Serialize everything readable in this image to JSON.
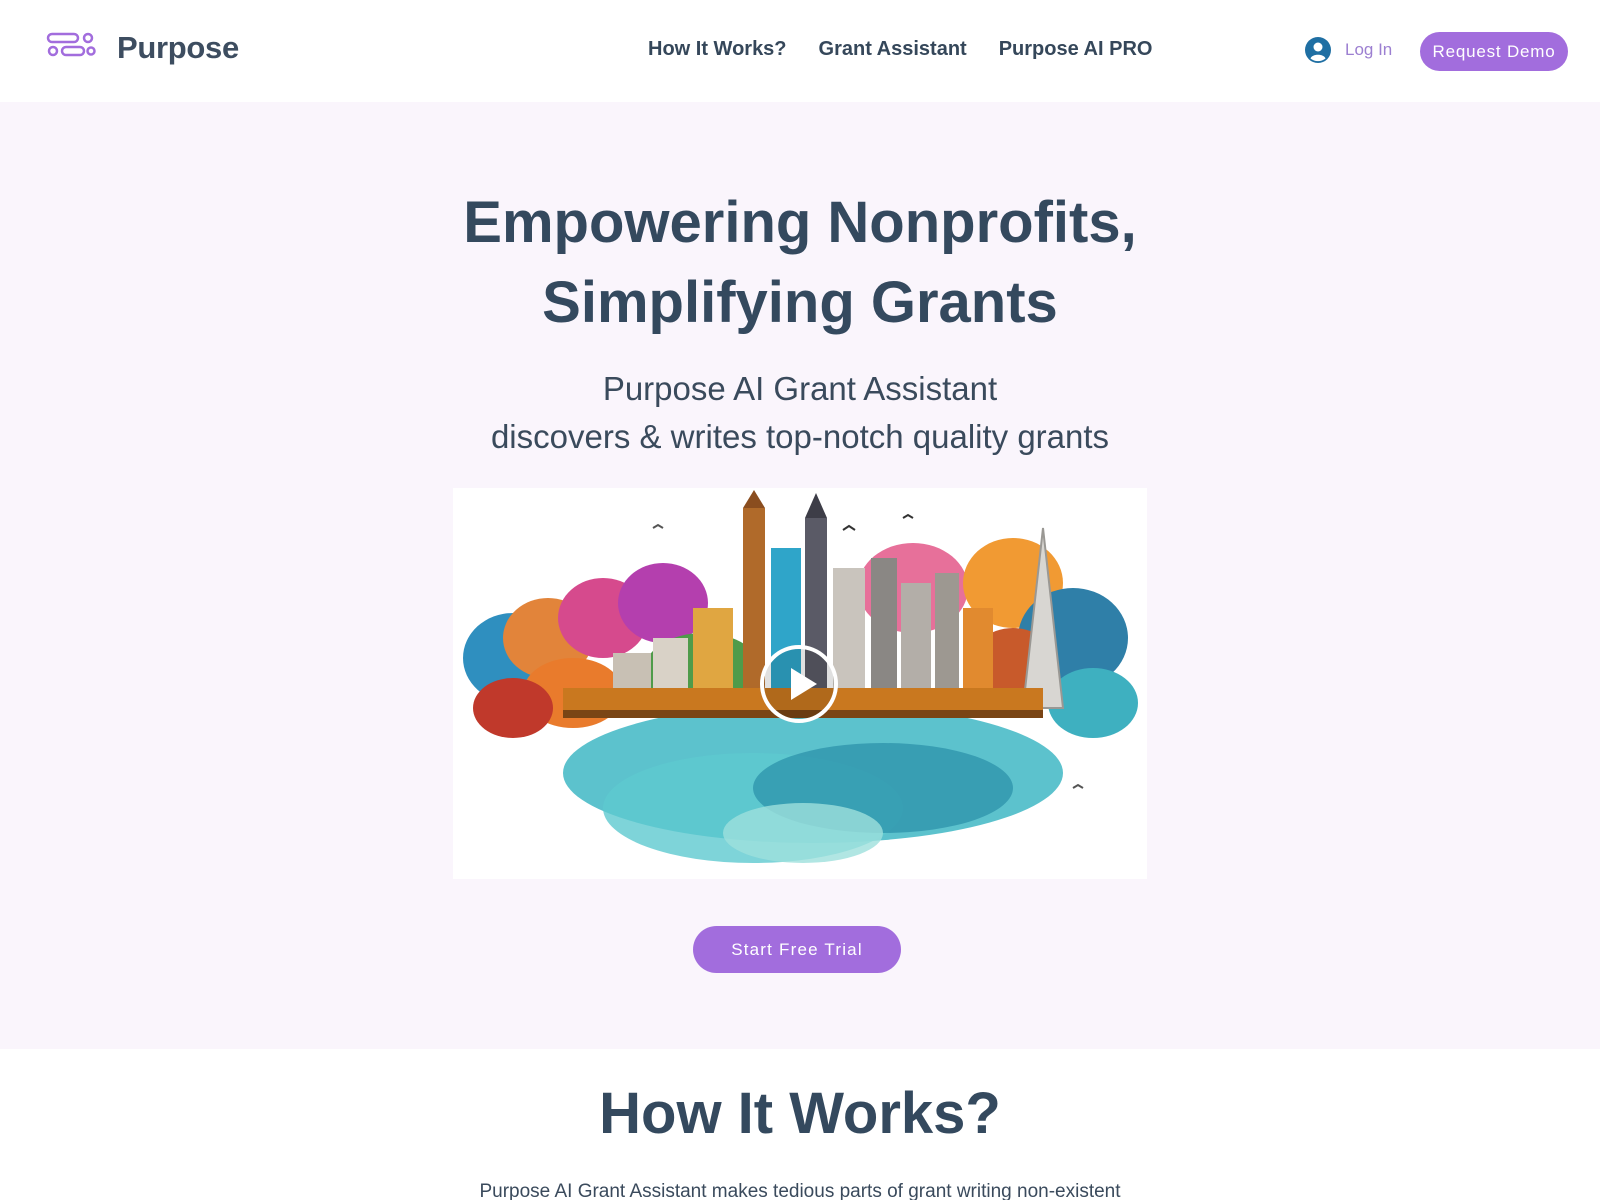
{
  "header": {
    "brand": "Purpose",
    "nav": [
      "How It Works?",
      "Grant Assistant",
      "Purpose AI PRO"
    ],
    "login_label": "Log In",
    "demo_label": "Request Demo",
    "logo_icon": "purpose-logo-icon",
    "login_icon": "user-avatar-icon"
  },
  "hero": {
    "headline_line1": "Empowering Nonprofits,",
    "headline_line2": "Simplifying Grants",
    "sub_line1": "Purpose AI Grant Assistant",
    "sub_line2": "discovers & writes top-notch quality grants",
    "video_icon": "play-icon",
    "cta_label": "Start Free Trial"
  },
  "how": {
    "title": "How It Works?",
    "text": "Purpose AI Grant Assistant makes tedious parts of grant writing non-existent"
  },
  "colors": {
    "accent": "#a26ddd",
    "hero_bg": "#faf5fc",
    "text": "#34495e",
    "login_icon": "#1f6fa3"
  }
}
